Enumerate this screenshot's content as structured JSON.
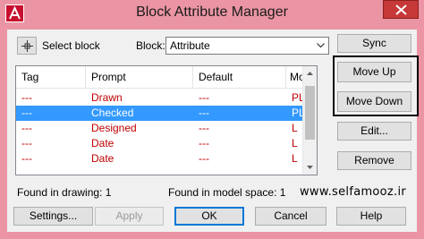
{
  "window": {
    "title": "Block Attribute Manager"
  },
  "top": {
    "select_block_label": "Select block",
    "block_label": "Block:",
    "block_value": "Attribute"
  },
  "buttons": {
    "sync": "Sync",
    "move_up": "Move Up",
    "move_down": "Move Down",
    "edit": "Edit...",
    "remove": "Remove",
    "settings": "Settings...",
    "apply": "Apply",
    "ok": "OK",
    "cancel": "Cancel",
    "help": "Help"
  },
  "table": {
    "columns": [
      "Tag",
      "Prompt",
      "Default",
      "Mode"
    ],
    "rows": [
      {
        "tag": "---",
        "prompt": "Drawn",
        "default": "---",
        "mode": "PL",
        "selected": false
      },
      {
        "tag": "---",
        "prompt": "Checked",
        "default": "---",
        "mode": "PL",
        "selected": true
      },
      {
        "tag": "---",
        "prompt": "Designed",
        "default": "---",
        "mode": "L",
        "selected": false
      },
      {
        "tag": "---",
        "prompt": "Date",
        "default": "---",
        "mode": "L",
        "selected": false
      },
      {
        "tag": "---",
        "prompt": "Date",
        "default": "---",
        "mode": "L",
        "selected": false
      }
    ]
  },
  "status": {
    "found_in_drawing": "Found in drawing: 1",
    "found_in_model_space": "Found in model space: 1"
  },
  "watermark": "www.selfamooz.ir",
  "colors": {
    "titlebar": "#eb95a4",
    "selection": "#3399ff",
    "row_text": "#c00000",
    "close": "#c73838"
  }
}
